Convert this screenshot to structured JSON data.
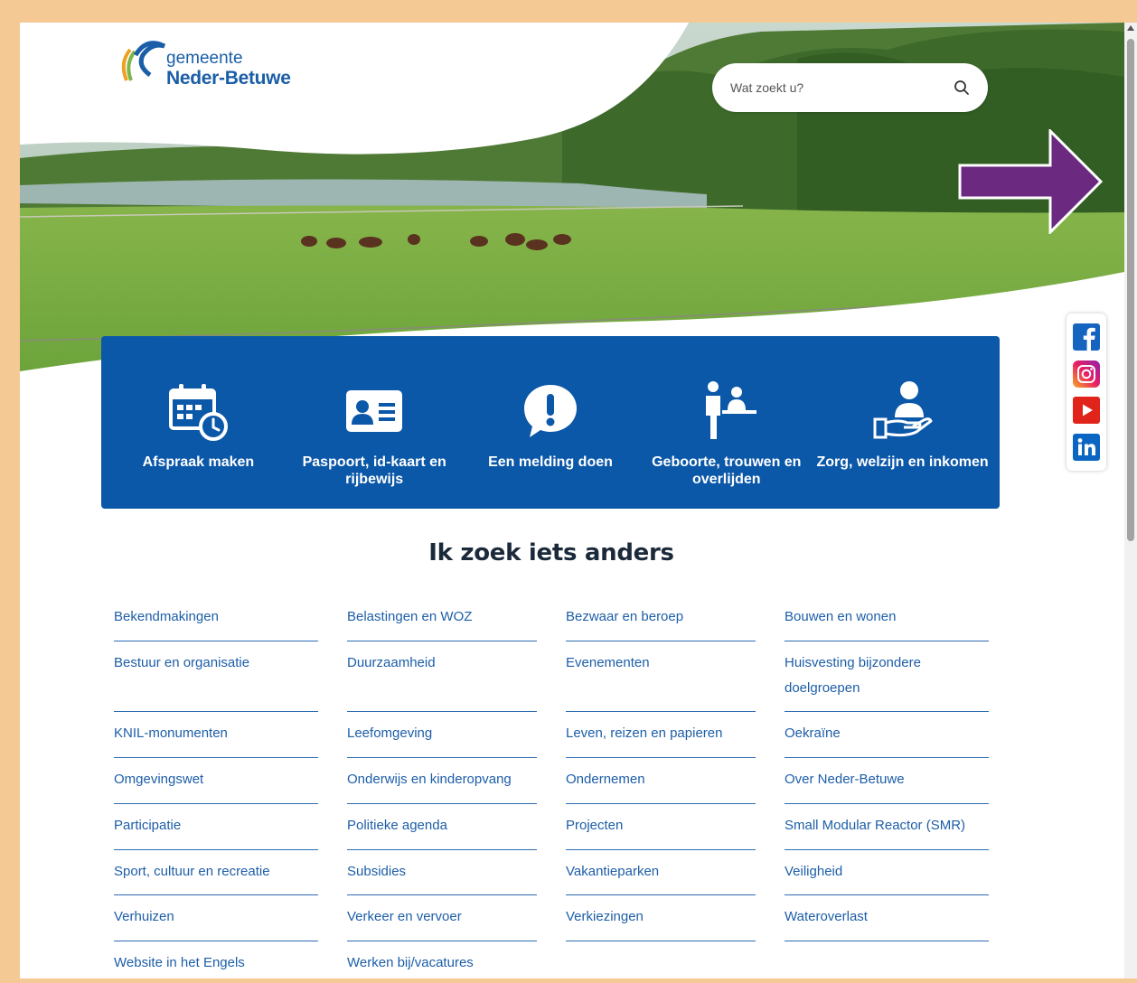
{
  "logo": {
    "line1": "gemeente",
    "line2": "Neder-Betuwe"
  },
  "search": {
    "placeholder": "Wat zoekt u?",
    "icon": "search-icon"
  },
  "tiles": [
    {
      "label": "Afspraak maken",
      "icon": "calendar-clock-icon"
    },
    {
      "label": "Paspoort, id-kaart en rijbewijs",
      "icon": "id-card-icon"
    },
    {
      "label": "Een melding doen",
      "icon": "exclamation-bubble-icon"
    },
    {
      "label": "Geboorte, trouwen en overlijden",
      "icon": "people-desk-icon"
    },
    {
      "label": "Zorg, welzijn en inkomen",
      "icon": "hand-person-icon"
    }
  ],
  "section_title": "Ik zoek iets anders",
  "links": [
    "Bekendmakingen",
    "Belastingen en WOZ",
    "Bezwaar en beroep",
    "Bouwen en wonen",
    "Bestuur en organisatie",
    "Duurzaamheid",
    "Evenementen",
    "Huisvesting bijzondere doelgroepen",
    "KNIL-monumenten",
    "Leefomgeving",
    "Leven, reizen en papieren",
    "Oekraïne",
    "Omgevingswet",
    "Onderwijs en kinderopvang",
    "Ondernemen",
    "Over Neder-Betuwe",
    "Participatie",
    "Politieke agenda",
    "Projecten",
    "Small Modular Reactor (SMR)",
    "Sport, cultuur en recreatie",
    "Subsidies",
    "Vakantieparken",
    "Veiligheid",
    "Verhuizen",
    "Verkeer en vervoer",
    "Verkiezingen",
    "Wateroverlast",
    "Website in het Engels",
    "Werken bij/vacatures"
  ],
  "social": [
    "facebook-icon",
    "instagram-icon",
    "youtube-icon",
    "linkedin-icon"
  ],
  "colors": {
    "brand_blue": "#0b57a8",
    "link_blue": "#1d5ea8",
    "frame": "#f5c994",
    "arrow": "#6b2a7f"
  }
}
